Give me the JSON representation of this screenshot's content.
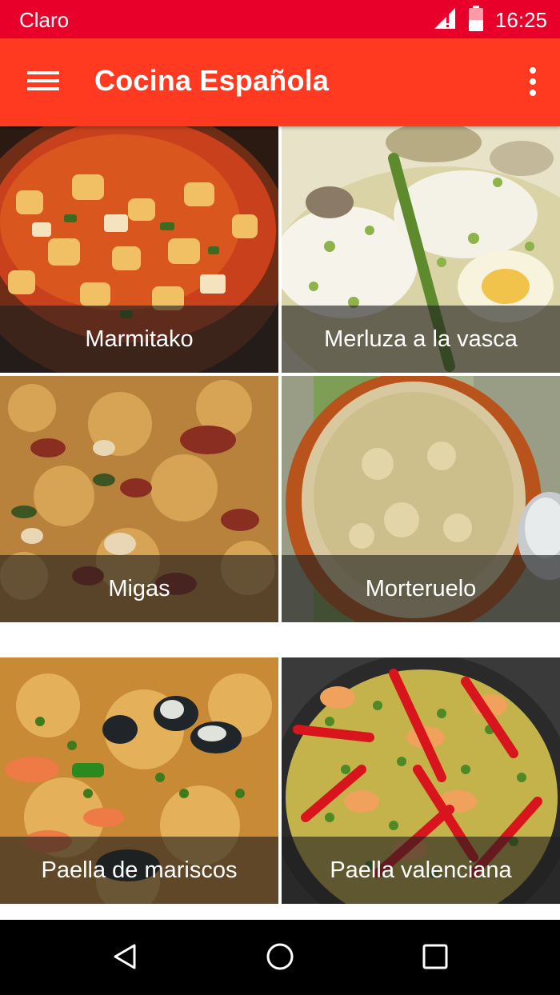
{
  "status_bar": {
    "carrier": "Claro",
    "time": "16:25",
    "icons": [
      "signal-icon",
      "battery-icon"
    ]
  },
  "app_bar": {
    "title": "Cocina Española",
    "menu_icon": "menu-icon",
    "overflow_icon": "more-vert-icon"
  },
  "recipes": [
    {
      "name": "Marmitako"
    },
    {
      "name": "Merluza a la vasca"
    },
    {
      "name": "Migas"
    },
    {
      "name": "Morteruelo"
    },
    {
      "name": "Paella de mariscos"
    },
    {
      "name": "Paella valenciana"
    }
  ],
  "nav": {
    "back_icon": "back-triangle-icon",
    "home_icon": "home-circle-icon",
    "recents_icon": "recents-square-icon"
  },
  "colors": {
    "status_bar": "#e8002b",
    "app_bar": "#ff3a20"
  }
}
